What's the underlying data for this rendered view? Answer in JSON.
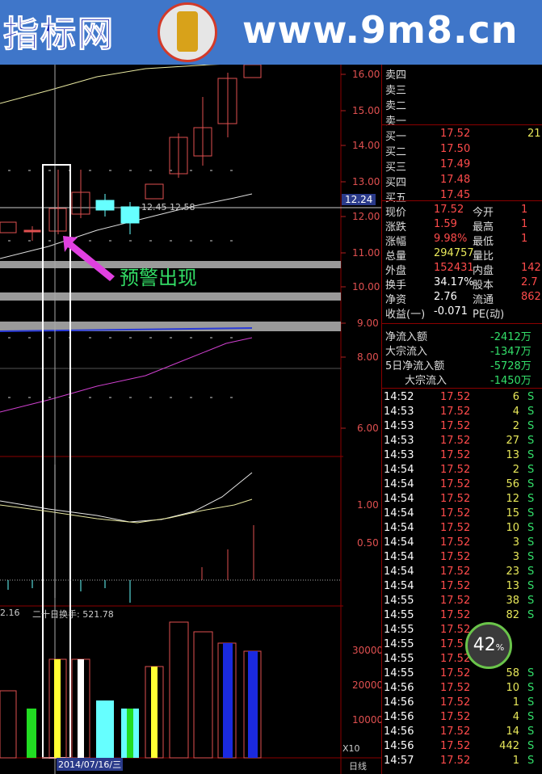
{
  "banner": {
    "brand": "指标网",
    "url": "www.9m8.cn"
  },
  "chart": {
    "price_axis": [
      "16.00",
      "15.00",
      "14.00",
      "13.00",
      "12.00",
      "11.00",
      "10.00",
      "9.00",
      "8.00",
      "6.00"
    ],
    "price_tag": "12.24",
    "ma_text": "12.45 12.58",
    "annotation": "预警出现",
    "indicator_axis": [
      "1.00",
      "0.50"
    ],
    "volume_header_left": "2.16",
    "volume_header": "二十日换手: 521.78",
    "volume_axis": [
      "30000",
      "20000",
      "10000"
    ],
    "volume_unit": "X10",
    "date_label": "2014/07/16/三",
    "period": "日线"
  },
  "quote": {
    "sell": [
      {
        "label": "卖四"
      },
      {
        "label": "卖三"
      },
      {
        "label": "卖二"
      },
      {
        "label": "卖一"
      }
    ],
    "buy": [
      {
        "label": "买一",
        "price": "17.52",
        "vol": "21"
      },
      {
        "label": "买二",
        "price": "17.50",
        "vol": ""
      },
      {
        "label": "买三",
        "price": "17.49",
        "vol": ""
      },
      {
        "label": "买四",
        "price": "17.48",
        "vol": ""
      },
      {
        "label": "买五",
        "price": "17.45",
        "vol": ""
      }
    ],
    "stats": [
      {
        "l1": "现价",
        "v1": "17.52",
        "c1": "red",
        "l2": "今开",
        "v2": "1"
      },
      {
        "l1": "涨跌",
        "v1": "1.59",
        "c1": "red",
        "l2": "最高",
        "v2": "1"
      },
      {
        "l1": "涨幅",
        "v1": "9.98%",
        "c1": "red",
        "l2": "最低",
        "v2": "1"
      },
      {
        "l1": "总量",
        "v1": "294757",
        "c1": "yel",
        "l2": "量比",
        "v2": ""
      },
      {
        "l1": "外盘",
        "v1": "152431",
        "c1": "red",
        "l2": "内盘",
        "v2": "142"
      },
      {
        "l1": "换手",
        "v1": "34.17%",
        "c1": "wht",
        "l2": "股本",
        "v2": "2.7"
      },
      {
        "l1": "净资",
        "v1": "2.76",
        "c1": "wht",
        "l2": "流通",
        "v2": "862"
      },
      {
        "l1": "收益(一)",
        "v1": "-0.071",
        "c1": "wht",
        "l2": "PE(动)",
        "v2": ""
      }
    ],
    "flows": [
      {
        "label": "净流入额",
        "value": "-2412万"
      },
      {
        "label": "大宗流入",
        "value": "-1347万"
      },
      {
        "label": "5日净流入额",
        "value": "-5728万"
      },
      {
        "label": "大宗流入",
        "value": "-1450万"
      }
    ]
  },
  "ticks": [
    {
      "time": "14:52",
      "price": "17.52",
      "vol": "6",
      "side": "S"
    },
    {
      "time": "14:53",
      "price": "17.52",
      "vol": "4",
      "side": "S"
    },
    {
      "time": "14:53",
      "price": "17.52",
      "vol": "2",
      "side": "S"
    },
    {
      "time": "14:53",
      "price": "17.52",
      "vol": "27",
      "side": "S"
    },
    {
      "time": "14:53",
      "price": "17.52",
      "vol": "13",
      "side": "S"
    },
    {
      "time": "14:54",
      "price": "17.52",
      "vol": "2",
      "side": "S"
    },
    {
      "time": "14:54",
      "price": "17.52",
      "vol": "56",
      "side": "S"
    },
    {
      "time": "14:54",
      "price": "17.52",
      "vol": "12",
      "side": "S"
    },
    {
      "time": "14:54",
      "price": "17.52",
      "vol": "15",
      "side": "S"
    },
    {
      "time": "14:54",
      "price": "17.52",
      "vol": "10",
      "side": "S"
    },
    {
      "time": "14:54",
      "price": "17.52",
      "vol": "3",
      "side": "S"
    },
    {
      "time": "14:54",
      "price": "17.52",
      "vol": "3",
      "side": "S"
    },
    {
      "time": "14:54",
      "price": "17.52",
      "vol": "23",
      "side": "S"
    },
    {
      "time": "14:54",
      "price": "17.52",
      "vol": "13",
      "side": "S"
    },
    {
      "time": "14:55",
      "price": "17.52",
      "vol": "38",
      "side": "S"
    },
    {
      "time": "14:55",
      "price": "17.52",
      "vol": "82",
      "side": "S"
    },
    {
      "time": "14:55",
      "price": "17.52",
      "vol": "",
      "side": ""
    },
    {
      "time": "14:55",
      "price": "17.5",
      "vol": "",
      "side": ""
    },
    {
      "time": "14:55",
      "price": "17.52",
      "vol": "",
      "side": ""
    },
    {
      "time": "14:55",
      "price": "17.52",
      "vol": "58",
      "side": "S"
    },
    {
      "time": "14:56",
      "price": "17.52",
      "vol": "10",
      "side": "S"
    },
    {
      "time": "14:56",
      "price": "17.52",
      "vol": "1",
      "side": "S"
    },
    {
      "time": "14:56",
      "price": "17.52",
      "vol": "4",
      "side": "S"
    },
    {
      "time": "14:56",
      "price": "17.52",
      "vol": "14",
      "side": "S"
    },
    {
      "time": "14:56",
      "price": "17.52",
      "vol": "442",
      "side": "S"
    },
    {
      "time": "14:57",
      "price": "17.52",
      "vol": "1",
      "side": "S"
    }
  ],
  "gauge": {
    "value": "42",
    "unit": "%"
  }
}
